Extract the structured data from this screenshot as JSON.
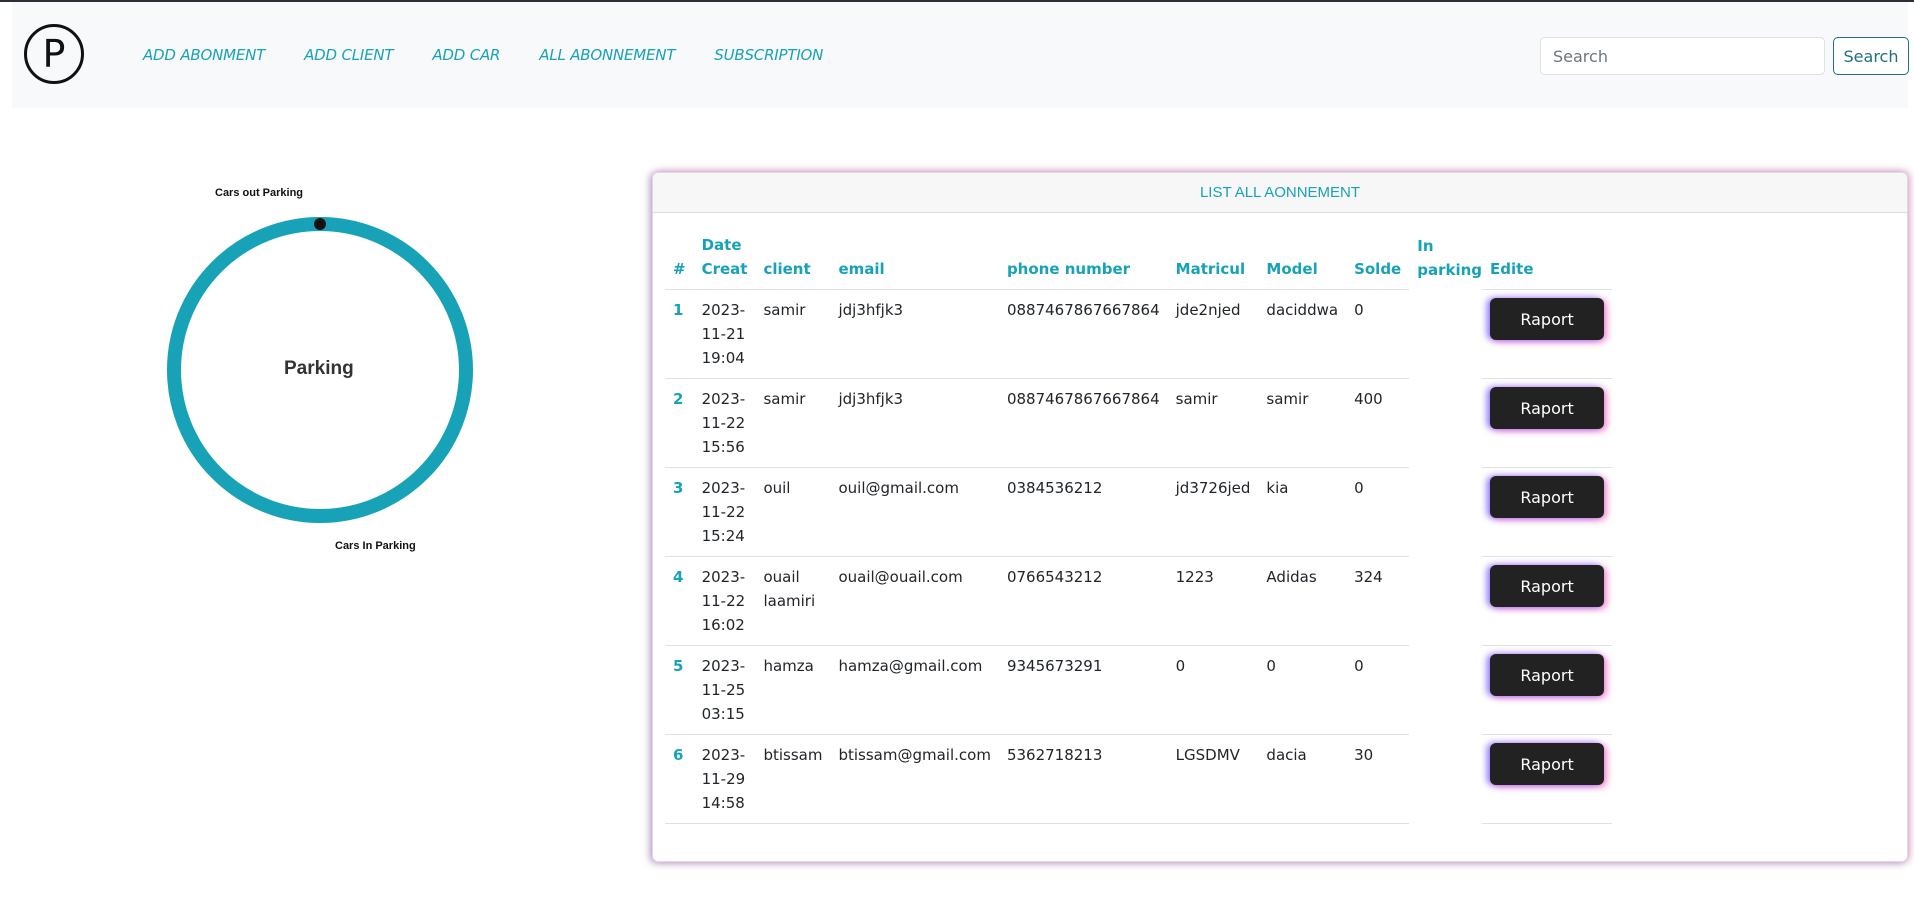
{
  "navbar": {
    "logo_letter": "P",
    "links": [
      "ADD ABONMENT",
      "ADD CLIENT",
      "ADD CAR",
      "ALL ABONNEMENT",
      "SUBSCRIPTION"
    ],
    "search_placeholder": "Search",
    "search_button": "Search"
  },
  "chart": {
    "center_label": "Parking",
    "label_out": "Cars out Parking",
    "label_in": "Cars In Parking",
    "colors": {
      "ring": "#17a2b8",
      "marker": "#111111"
    }
  },
  "chart_data": {
    "type": "pie",
    "categories": [
      "Cars out Parking",
      "Cars In Parking"
    ],
    "values": [
      0,
      6
    ],
    "title": "Parking"
  },
  "card": {
    "title": "LIST ALL AONNEMENT",
    "headers": [
      "#",
      "Date Creat",
      "client",
      "email",
      "phone number",
      "Matricul",
      "Model",
      "Solde",
      "In parking",
      "Edite"
    ],
    "rows": [
      {
        "num": "1",
        "date": "2023-11-21 19:04",
        "client": "samir",
        "email": "jdj3hfjk3",
        "phone": "0887467867667864",
        "matricul": "jde2njed",
        "model": "daciddwa",
        "solde": "0",
        "action": "Raport"
      },
      {
        "num": "2",
        "date": "2023-11-22 15:56",
        "client": "samir",
        "email": "jdj3hfjk3",
        "phone": "0887467867667864",
        "matricul": "samir",
        "model": "samir",
        "solde": "400",
        "action": "Raport"
      },
      {
        "num": "3",
        "date": "2023-11-22 15:24",
        "client": "ouil",
        "email": "ouil@gmail.com",
        "phone": "0384536212",
        "matricul": "jd3726jed",
        "model": "kia",
        "solde": "0",
        "action": "Raport"
      },
      {
        "num": "4",
        "date": "2023-11-22 16:02",
        "client": "ouail laamiri",
        "email": "ouail@ouail.com",
        "phone": "0766543212",
        "matricul": "1223",
        "model": "Adidas",
        "solde": "324",
        "action": "Raport"
      },
      {
        "num": "5",
        "date": "2023-11-25 03:15",
        "client": "hamza",
        "email": "hamza@gmail.com",
        "phone": "9345673291",
        "matricul": "0",
        "model": "0",
        "solde": "0",
        "action": "Raport"
      },
      {
        "num": "6",
        "date": "2023-11-29 14:58",
        "client": "btissam",
        "email": "btissam@gmail.com",
        "phone": "5362718213",
        "matricul": "LGSDMV",
        "model": "dacia",
        "solde": "30",
        "action": "Raport"
      }
    ]
  }
}
